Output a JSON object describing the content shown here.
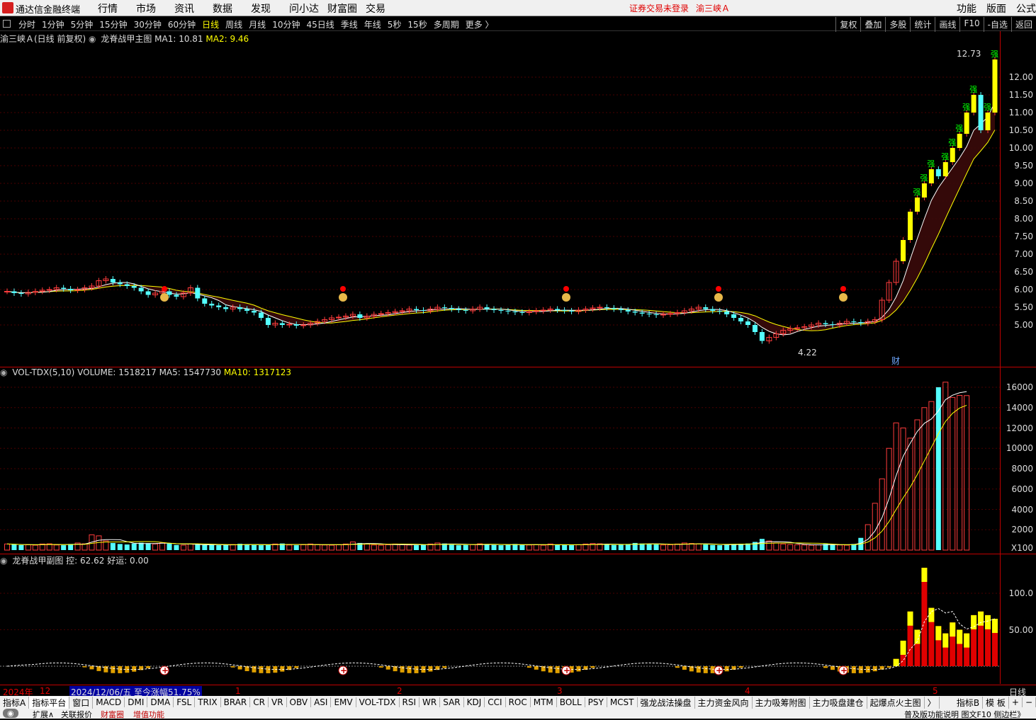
{
  "app": {
    "name": "通达信金融终端",
    "status": "证券交易未登录",
    "stock_name": "渝三峡Ａ"
  },
  "menu": [
    "行情",
    "市场",
    "资讯",
    "数据",
    "发现",
    "问小达",
    "财富圈",
    "交易"
  ],
  "menu_right": [
    "功能",
    "版面",
    "公式"
  ],
  "periods": [
    "分时",
    "1分钟",
    "5分钟",
    "15分钟",
    "30分钟",
    "60分钟",
    "日线",
    "周线",
    "月线",
    "10分钟",
    "45日线",
    "季线",
    "年线",
    "5秒",
    "15秒",
    "多周期",
    "更多 〉"
  ],
  "active_period": "日线",
  "tools": [
    "复权",
    "叠加",
    "多股",
    "统计",
    "画线",
    "F10",
    "-自选",
    "返回"
  ],
  "main_pane": {
    "title": "渝三峡Ａ(日线 前复权)",
    "indicator": "龙脊战甲主图",
    "ma1": "MA1: 10.81",
    "ma2": "MA2: 9.46",
    "high_label": "12.73",
    "low_label": "4.22",
    "badge": "财",
    "y_ticks": [
      "12.00",
      "11.50",
      "11.00",
      "10.50",
      "10.00",
      "9.50",
      "9.00",
      "8.50",
      "8.00",
      "7.50",
      "7.00",
      "6.50",
      "6.00",
      "5.50",
      "5.00"
    ],
    "strong_marker": "强"
  },
  "vol_pane": {
    "name": "VOL-TDX(5,10)",
    "volume": "VOLUME: 1518217",
    "ma5": "MA5: 1547730",
    "ma10": "MA10: 1317123",
    "y_ticks": [
      "16000",
      "14000",
      "12000",
      "10000",
      "8000",
      "6000",
      "4000",
      "2000"
    ],
    "unit": "X100"
  },
  "sub_pane": {
    "name": "龙脊战甲副图",
    "kong": "控: 62.62",
    "haoyun": "好运: 0.00",
    "y_ticks": [
      "100.0",
      "50.00"
    ]
  },
  "date_bar": {
    "year": "2024年",
    "m12": "12",
    "selected": "2024/12/06/五  至今涨幅51.75%",
    "months": [
      "1",
      "2",
      "3",
      "4",
      "5"
    ],
    "period": "日线"
  },
  "indicator_tabs": [
    "指标A",
    "指标平台",
    "窗口",
    "MACD",
    "DMI",
    "DMA",
    "FSL",
    "TRIX",
    "BRAR",
    "CR",
    "VR",
    "OBV",
    "ASI",
    "EMV",
    "VOL-TDX",
    "RSI",
    "WR",
    "SAR",
    "KDJ",
    "CCI",
    "ROC",
    "MTM",
    "BOLL",
    "PSY",
    "MCST",
    "强龙战法操盘",
    "主力资金风向",
    "主力吸筹附图",
    "主力吸盘建仓",
    "起爆点火主图",
    "〉"
  ],
  "indicator_right": [
    "指标B",
    "模 板",
    "+",
    "−"
  ],
  "status_bar": {
    "left": "扩展∧",
    "items": [
      "关联报价",
      "财富圈",
      "增值功能"
    ],
    "right": "普及版功能说明  图文F10  侧边栏》"
  },
  "colors": {
    "up": "#ff3c3c",
    "down": "#54ffff",
    "ma1": "#ffffff",
    "ma2": "#ffff00",
    "axis": "#c00000",
    "strong": "#ffff00"
  },
  "chart_data": {
    "type": "candlestick",
    "title": "渝三峡Ａ(日线 前复权)",
    "ylim": [
      4.0,
      13.0
    ],
    "series": [
      {
        "name": "MA1",
        "last": 10.81
      },
      {
        "name": "MA2",
        "last": 9.46
      }
    ],
    "closes": [
      5.95,
      5.9,
      5.88,
      5.92,
      5.95,
      5.98,
      6.0,
      6.05,
      6.02,
      5.98,
      6.0,
      6.05,
      6.1,
      6.25,
      6.3,
      6.2,
      6.15,
      6.1,
      6.05,
      5.95,
      5.85,
      5.9,
      5.95,
      5.85,
      5.8,
      5.9,
      6.05,
      5.75,
      5.6,
      5.55,
      5.5,
      5.45,
      5.5,
      5.45,
      5.4,
      5.35,
      5.2,
      5.0,
      5.05,
      5.0,
      5.02,
      4.98,
      5.0,
      5.05,
      5.1,
      5.15,
      5.2,
      5.22,
      5.25,
      5.3,
      5.2,
      5.25,
      5.3,
      5.32,
      5.35,
      5.38,
      5.4,
      5.45,
      5.42,
      5.4,
      5.45,
      5.5,
      5.48,
      5.45,
      5.42,
      5.4,
      5.45,
      5.5,
      5.45,
      5.42,
      5.4,
      5.38,
      5.36,
      5.35,
      5.38,
      5.4,
      5.42,
      5.45,
      5.42,
      5.4,
      5.38,
      5.42,
      5.45,
      5.48,
      5.5,
      5.48,
      5.45,
      5.42,
      5.38,
      5.35,
      5.32,
      5.3,
      5.28,
      5.3,
      5.32,
      5.35,
      5.4,
      5.45,
      5.5,
      5.45,
      5.4,
      5.38,
      5.3,
      5.2,
      5.1,
      5.0,
      4.8,
      4.55,
      4.65,
      4.75,
      4.85,
      4.9,
      4.92,
      4.95,
      5.0,
      5.05,
      5.02,
      5.0,
      5.05,
      5.1,
      5.08,
      5.05,
      5.1,
      5.15,
      5.7,
      6.2,
      6.8,
      7.4,
      8.2,
      8.6,
      9.0,
      9.4,
      9.2,
      9.6,
      10.0,
      10.4,
      11.0,
      11.5,
      10.5,
      11.0,
      12.5
    ],
    "volume": [
      600,
      550,
      500,
      520,
      480,
      600,
      620,
      500,
      480,
      600,
      700,
      620,
      1500,
      1400,
      900,
      700,
      600,
      550,
      650,
      720,
      680,
      600,
      720,
      650,
      500,
      480,
      600,
      550,
      500,
      520,
      480,
      500,
      550,
      620,
      580,
      500,
      480,
      520,
      600,
      650,
      500,
      480,
      520,
      600,
      550,
      500,
      480,
      520,
      600,
      800,
      700,
      600,
      500,
      480,
      520,
      600,
      550,
      500,
      480,
      520,
      600,
      700,
      650,
      520,
      480,
      500,
      550,
      620,
      580,
      500,
      480,
      520,
      600,
      550,
      500,
      520,
      480,
      600,
      550,
      500,
      480,
      520,
      600,
      650,
      620,
      550,
      500,
      520,
      600,
      700,
      650,
      600,
      550,
      500,
      520,
      600,
      700,
      650,
      600,
      550,
      500,
      480,
      520,
      600,
      620,
      650,
      800,
      1100,
      900,
      700,
      600,
      550,
      520,
      500,
      480,
      520,
      600,
      550,
      500,
      480,
      600,
      1200,
      2500,
      4600,
      7000,
      10000,
      12500,
      12000,
      11000,
      12800,
      14000,
      14600,
      16000,
      16500,
      15000,
      15200,
      15182
    ],
    "y_ticks": [
      5.0,
      5.5,
      6.0,
      6.5,
      7.0,
      7.5,
      8.0,
      8.5,
      9.0,
      9.5,
      10.0,
      10.5,
      11.0,
      11.5,
      12.0
    ]
  }
}
